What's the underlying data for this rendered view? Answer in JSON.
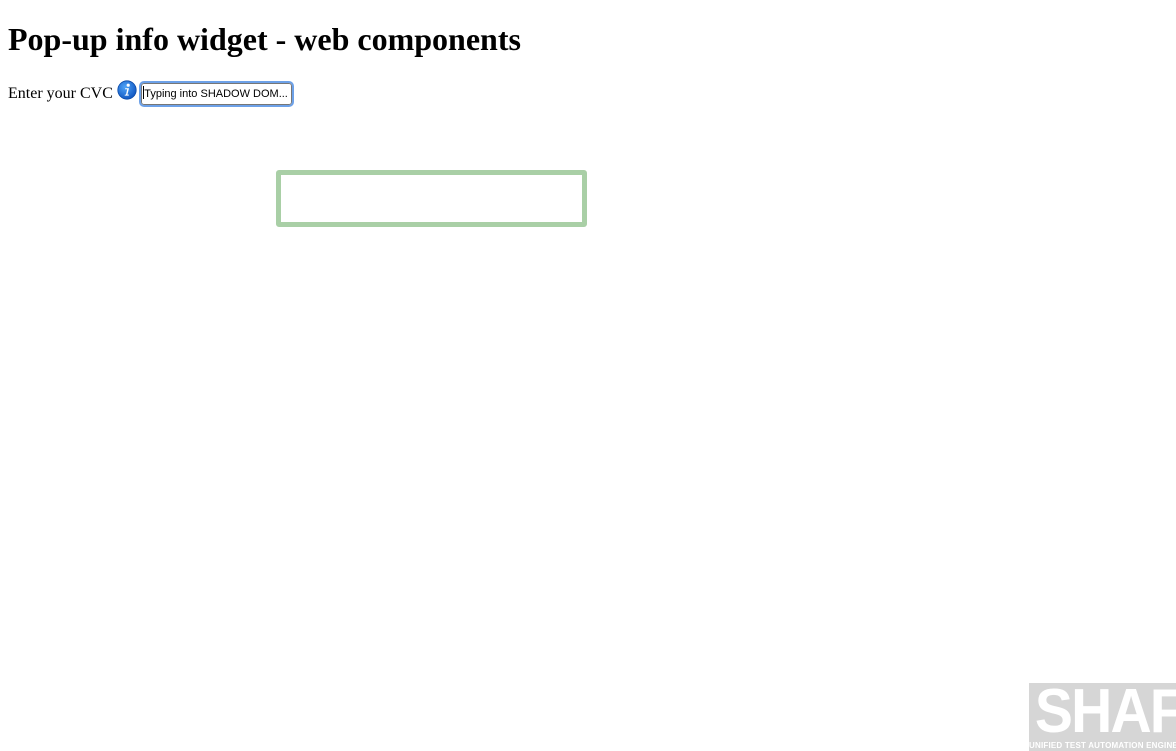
{
  "page": {
    "title": "Pop-up info widget - web components"
  },
  "cvc": {
    "label": "Enter your CVC",
    "input_value": "Typing into SHADOW DOM...",
    "info_icon": "info-icon"
  },
  "popup": {
    "text": ""
  },
  "logo": {
    "word": "SHAFT",
    "tagline": "UNIFIED TEST AUTOMATION ENGINE"
  },
  "colors": {
    "popup_border": "#a9cfa6",
    "input_focus": "#6da1e8",
    "info_icon_blue": "#1a6fd6",
    "logo_gray": "#d6d6d6"
  }
}
